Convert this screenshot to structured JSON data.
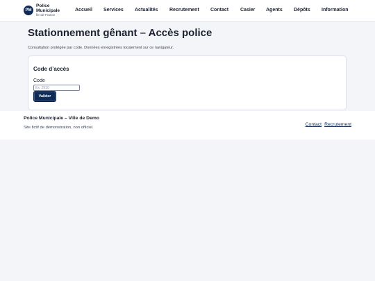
{
  "brand": {
    "logo_text": "PM",
    "name_line1": "Police",
    "name_line2": "Municipale",
    "region": "Île-de-France"
  },
  "nav": {
    "items": [
      {
        "label": "Accueil"
      },
      {
        "label": "Services"
      },
      {
        "label": "Actualités"
      },
      {
        "label": "Recrutement"
      },
      {
        "label": "Contact"
      },
      {
        "label": "Casier"
      },
      {
        "label": "Agents"
      },
      {
        "label": "Dépôts"
      },
      {
        "label": "Information"
      }
    ]
  },
  "main": {
    "title": "Stationnement gênant – Accès police",
    "description": "Consultation protégée par code. Données enregistrées localement sur ce navigateur.",
    "card": {
      "title": "Code d’accès",
      "field_label": "Code",
      "input_value": "",
      "input_placeholder": "Ex: 2910",
      "submit_label": "Valider"
    }
  },
  "footer": {
    "title": "Police Municipale – Ville de Demo",
    "note": "Site fictif de démonstration, non officiel.",
    "links": [
      {
        "label": "Contact"
      },
      {
        "label": "Recrutement"
      }
    ]
  },
  "colors": {
    "brand": "#0f2a55",
    "background": "#f4f5f8",
    "surface": "#ffffff",
    "text": "#1b2130"
  }
}
